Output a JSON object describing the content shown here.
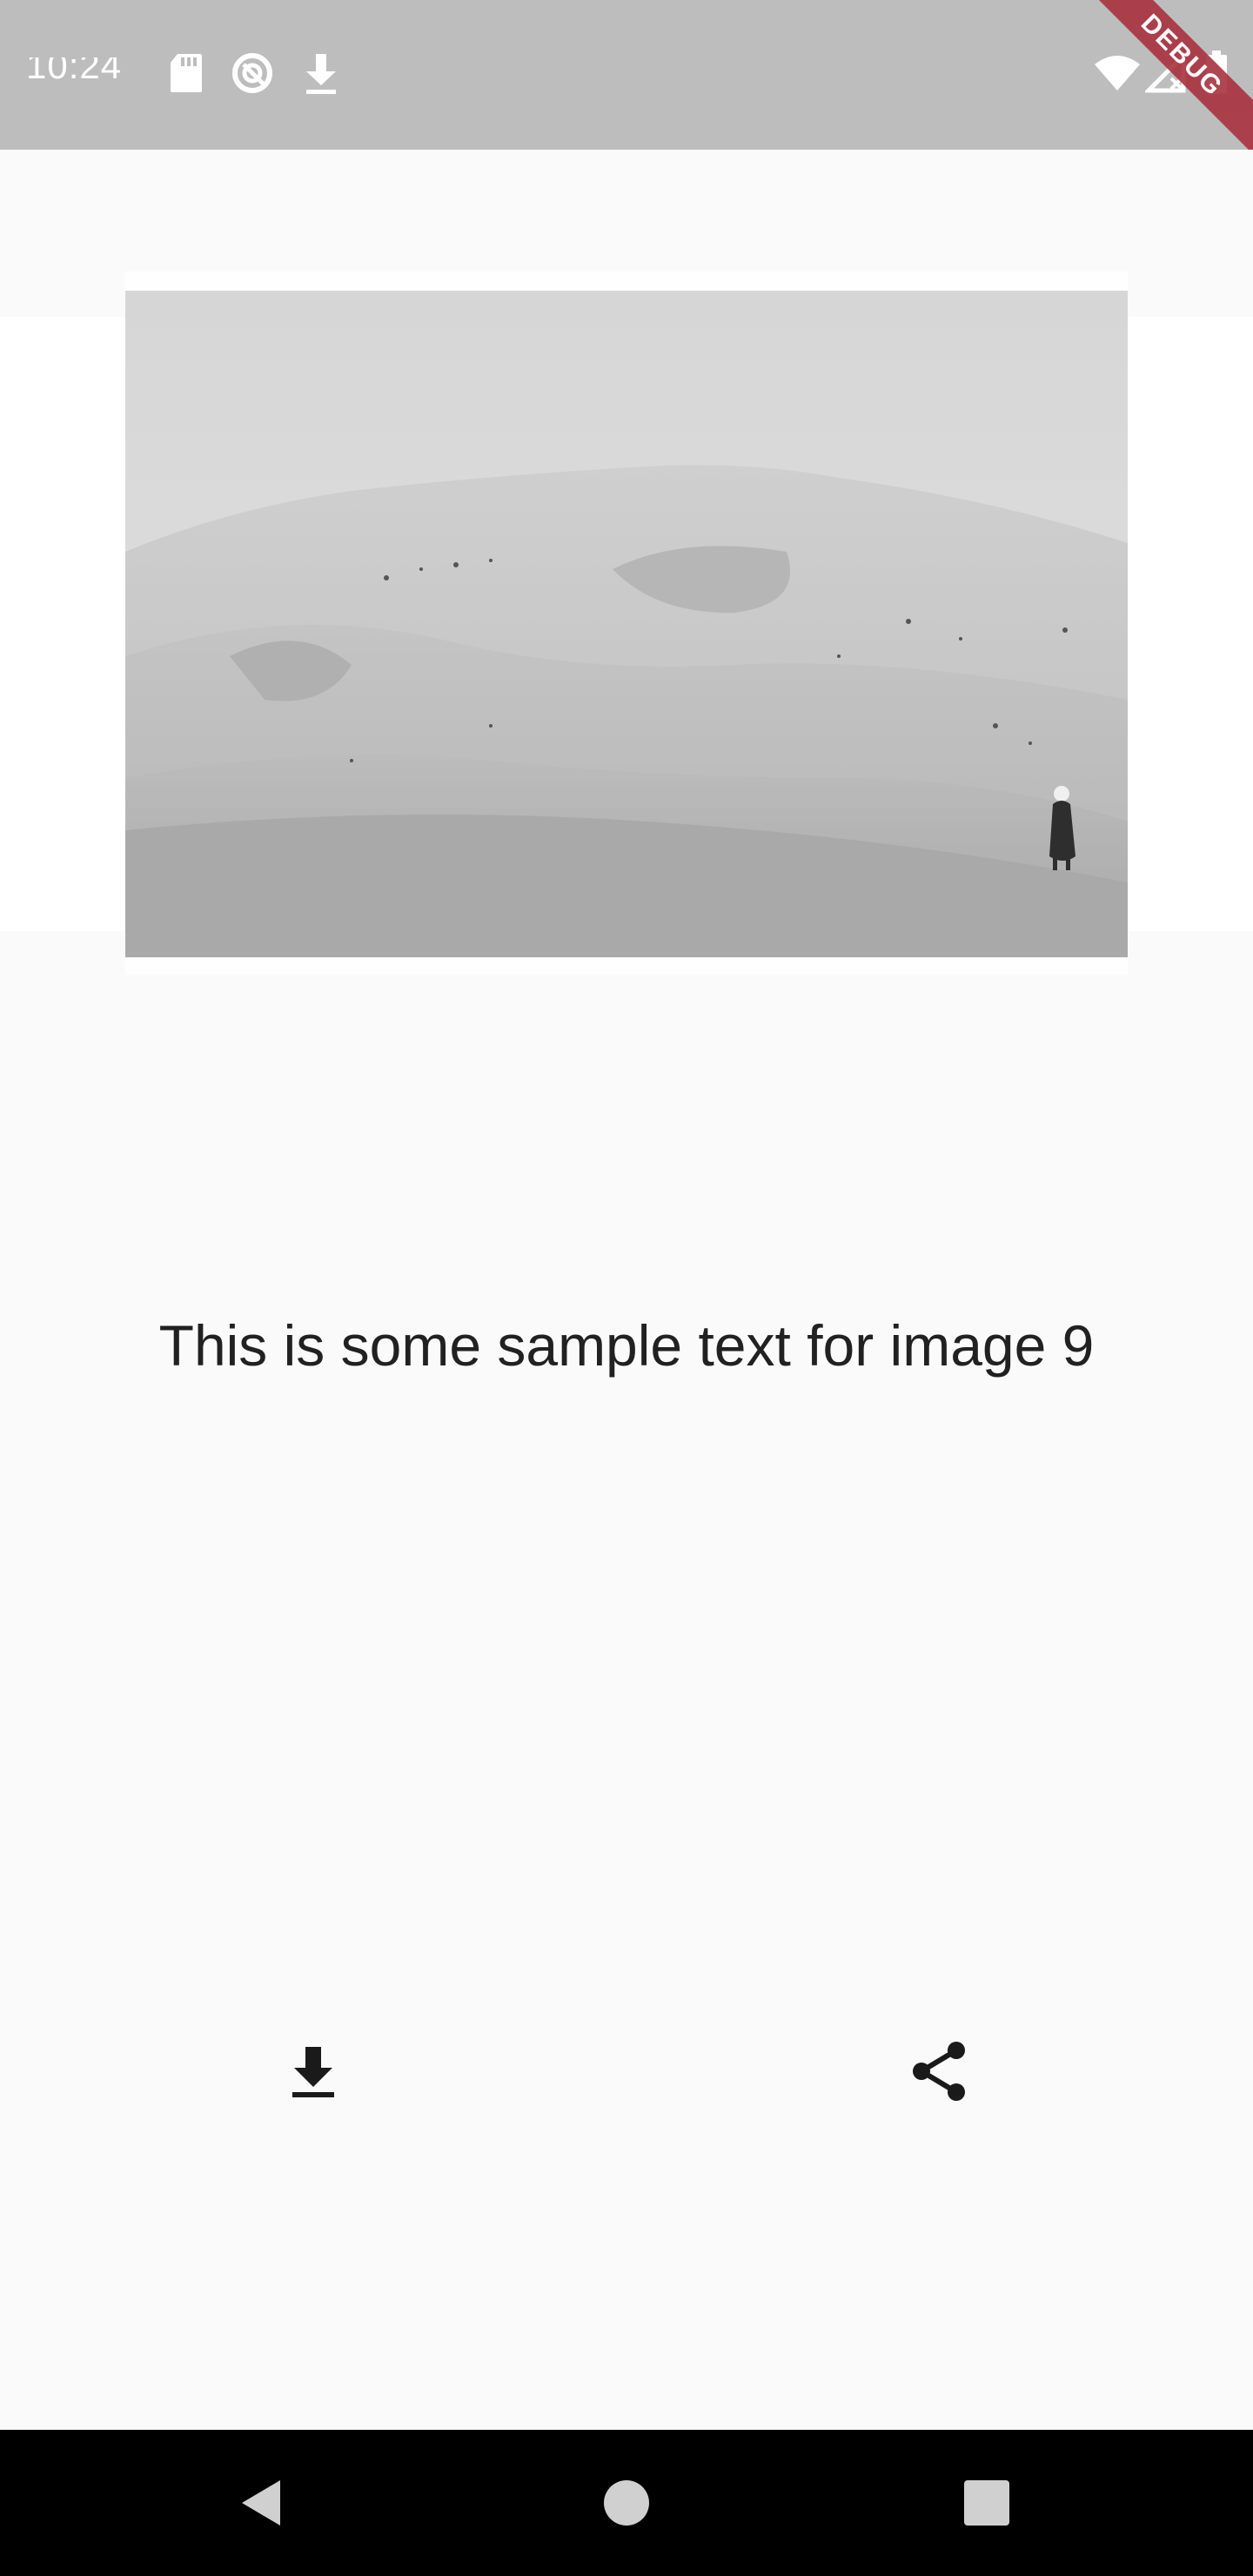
{
  "status_bar": {
    "time": "10:24",
    "icons": [
      "sd-card-icon",
      "data-saver-icon",
      "download-icon",
      "wifi-icon",
      "no-signal-icon",
      "battery-icon"
    ],
    "background": "#bdbdbd"
  },
  "debug_banner": {
    "label": "DEBUG",
    "color": "#a8323f"
  },
  "content": {
    "image_alt": "Desert sand dunes with a person walking",
    "caption": "This is some sample text for image 9"
  },
  "actions": {
    "download_icon": "download-icon",
    "share_icon": "share-icon"
  },
  "nav_bar": {
    "buttons": [
      "back-icon",
      "home-icon",
      "recents-icon"
    ],
    "background": "#000000"
  }
}
